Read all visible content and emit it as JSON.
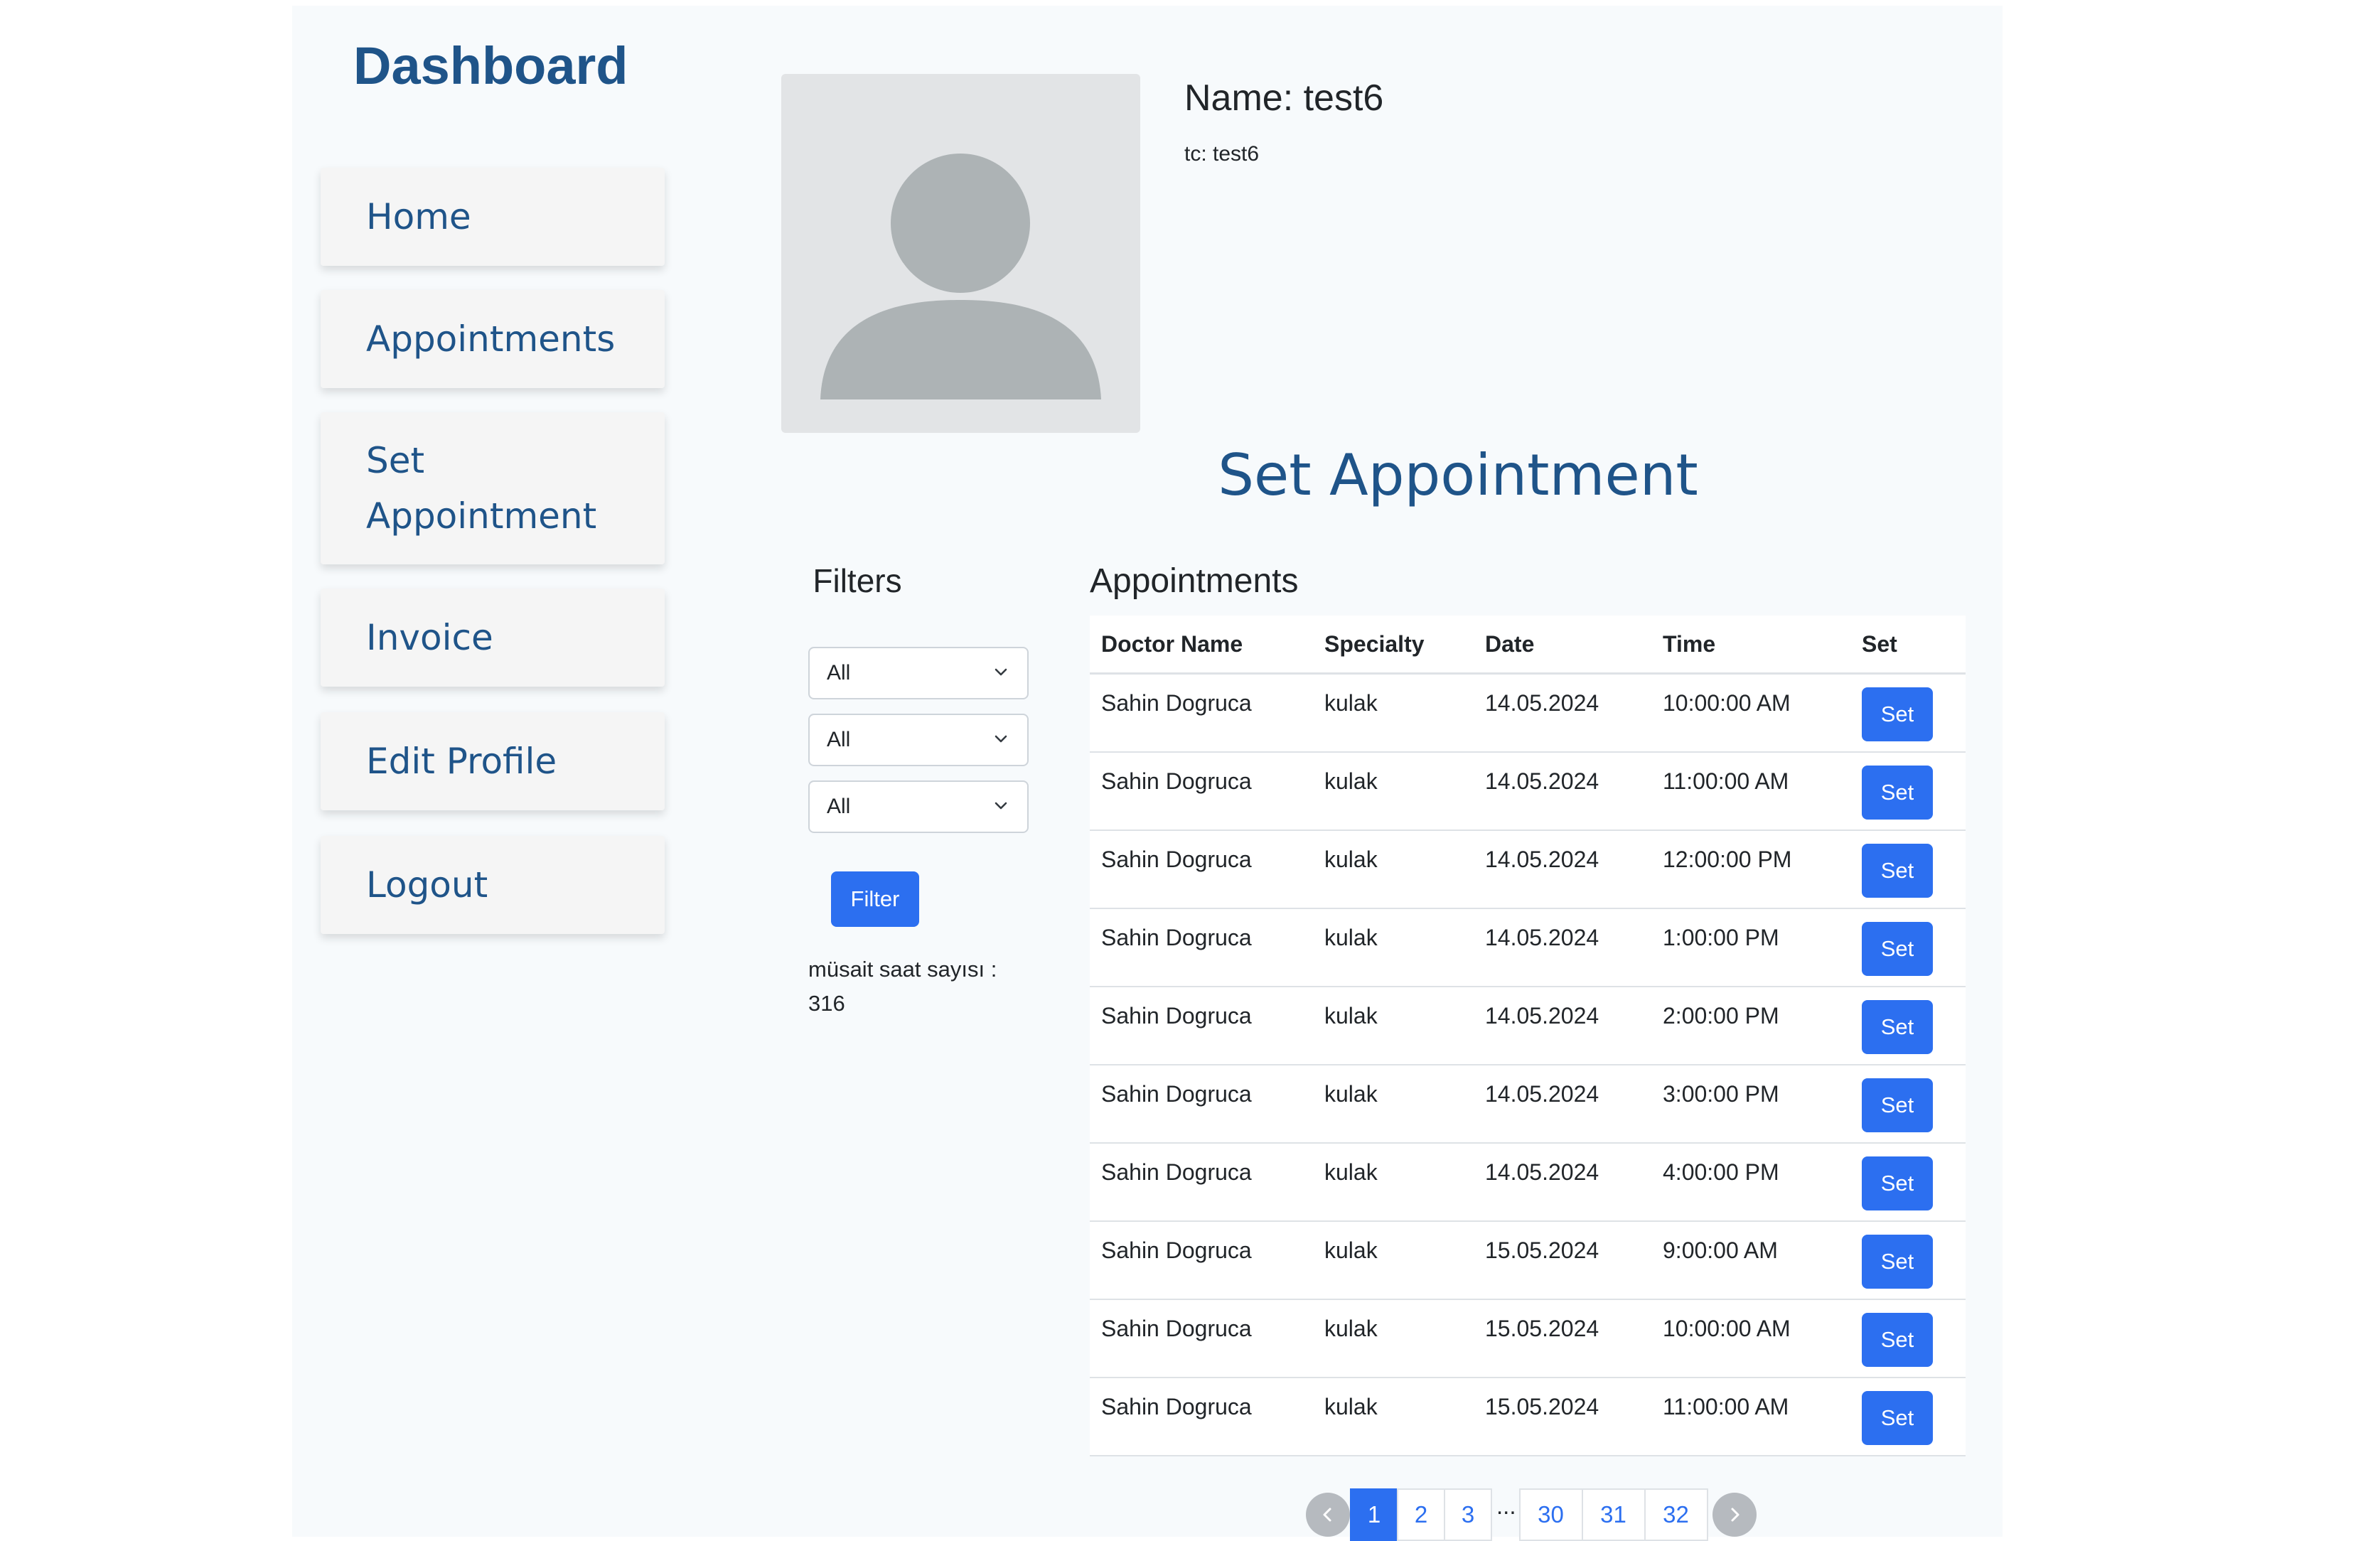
{
  "sidebar": {
    "brand": "Dashboard",
    "items": [
      {
        "label": "Home"
      },
      {
        "label": "Appointments"
      },
      {
        "label": "Set Appointment"
      },
      {
        "label": "Invoice"
      },
      {
        "label": "Edit Profile"
      },
      {
        "label": "Logout"
      }
    ]
  },
  "profile": {
    "name": "Name: test6",
    "tc": "tc: test6",
    "avatar_icon": "user-silhouette-icon"
  },
  "main": {
    "title": "Set Appointment"
  },
  "filters": {
    "title": "Filters",
    "selects": [
      {
        "value": "All"
      },
      {
        "value": "All"
      },
      {
        "value": "All"
      }
    ],
    "button_label": "Filter",
    "count_text": "müsait saat sayısı : 316"
  },
  "appointments": {
    "title": "Appointments",
    "columns": [
      "Doctor Name",
      "Specialty",
      "Date",
      "Time",
      "Set"
    ],
    "rows": [
      {
        "doctor": "Sahin Dogruca",
        "specialty": "kulak",
        "date": "14.05.2024",
        "time": "10:00:00 AM",
        "action": "Set"
      },
      {
        "doctor": "Sahin Dogruca",
        "specialty": "kulak",
        "date": "14.05.2024",
        "time": "11:00:00 AM",
        "action": "Set"
      },
      {
        "doctor": "Sahin Dogruca",
        "specialty": "kulak",
        "date": "14.05.2024",
        "time": "12:00:00 PM",
        "action": "Set"
      },
      {
        "doctor": "Sahin Dogruca",
        "specialty": "kulak",
        "date": "14.05.2024",
        "time": "1:00:00 PM",
        "action": "Set"
      },
      {
        "doctor": "Sahin Dogruca",
        "specialty": "kulak",
        "date": "14.05.2024",
        "time": "2:00:00 PM",
        "action": "Set"
      },
      {
        "doctor": "Sahin Dogruca",
        "specialty": "kulak",
        "date": "14.05.2024",
        "time": "3:00:00 PM",
        "action": "Set"
      },
      {
        "doctor": "Sahin Dogruca",
        "specialty": "kulak",
        "date": "14.05.2024",
        "time": "4:00:00 PM",
        "action": "Set"
      },
      {
        "doctor": "Sahin Dogruca",
        "specialty": "kulak",
        "date": "15.05.2024",
        "time": "9:00:00 AM",
        "action": "Set"
      },
      {
        "doctor": "Sahin Dogruca",
        "specialty": "kulak",
        "date": "15.05.2024",
        "time": "10:00:00 AM",
        "action": "Set"
      },
      {
        "doctor": "Sahin Dogruca",
        "specialty": "kulak",
        "date": "15.05.2024",
        "time": "11:00:00 AM",
        "action": "Set"
      }
    ]
  },
  "pagination": {
    "prev_icon": "chevron-left-icon",
    "next_icon": "chevron-right-icon",
    "pages_before": [
      "1",
      "2",
      "3"
    ],
    "ellipsis": "...",
    "pages_after": [
      "30",
      "31",
      "32"
    ],
    "active": "1"
  },
  "colors": {
    "brand": "#1f5489",
    "accent": "#2c6ff0",
    "background": "#f7fafc"
  }
}
